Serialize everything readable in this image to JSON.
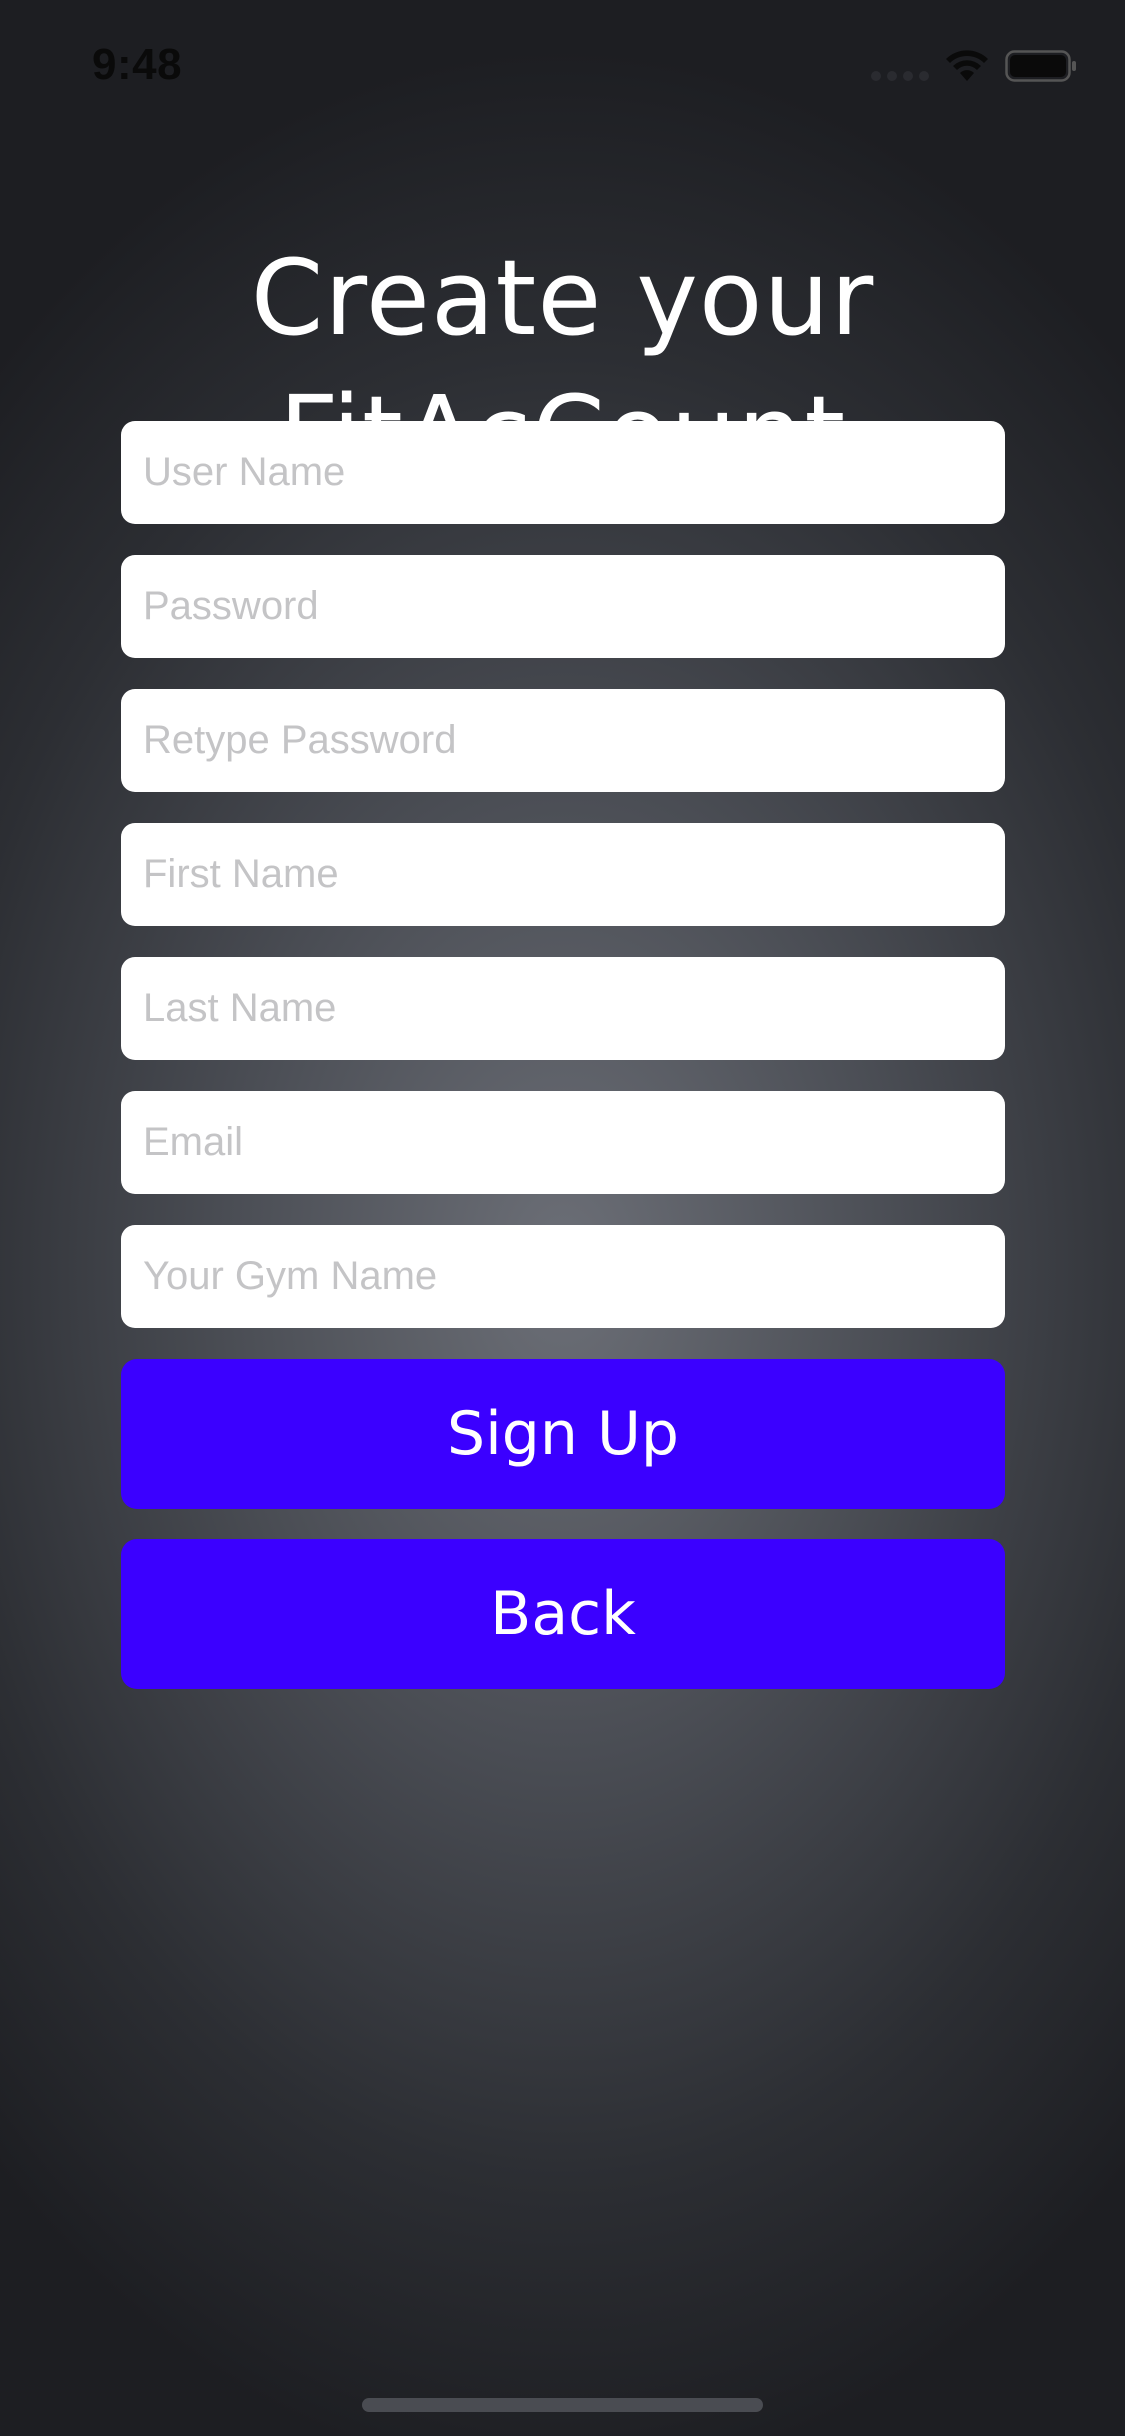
{
  "status_bar": {
    "time": "9:48"
  },
  "title": {
    "line1": "Create your",
    "line2": "FitAcCount"
  },
  "fields": [
    {
      "placeholder": "User Name",
      "value": ""
    },
    {
      "placeholder": "Password",
      "value": ""
    },
    {
      "placeholder": "Retype Password",
      "value": ""
    },
    {
      "placeholder": "First Name",
      "value": ""
    },
    {
      "placeholder": "Last Name",
      "value": ""
    },
    {
      "placeholder": "Email",
      "value": ""
    },
    {
      "placeholder": "Your Gym Name",
      "value": ""
    }
  ],
  "buttons": {
    "signup_label": "Sign Up",
    "back_label": "Back"
  },
  "colors": {
    "button_bg": "#3b00ff",
    "field_bg": "#ffffff",
    "placeholder": "#c4c4c6",
    "title_text": "#ffffff"
  },
  "icons": {
    "signal": "cellular-signal-icon",
    "wifi": "wifi-icon",
    "battery": "battery-icon"
  }
}
